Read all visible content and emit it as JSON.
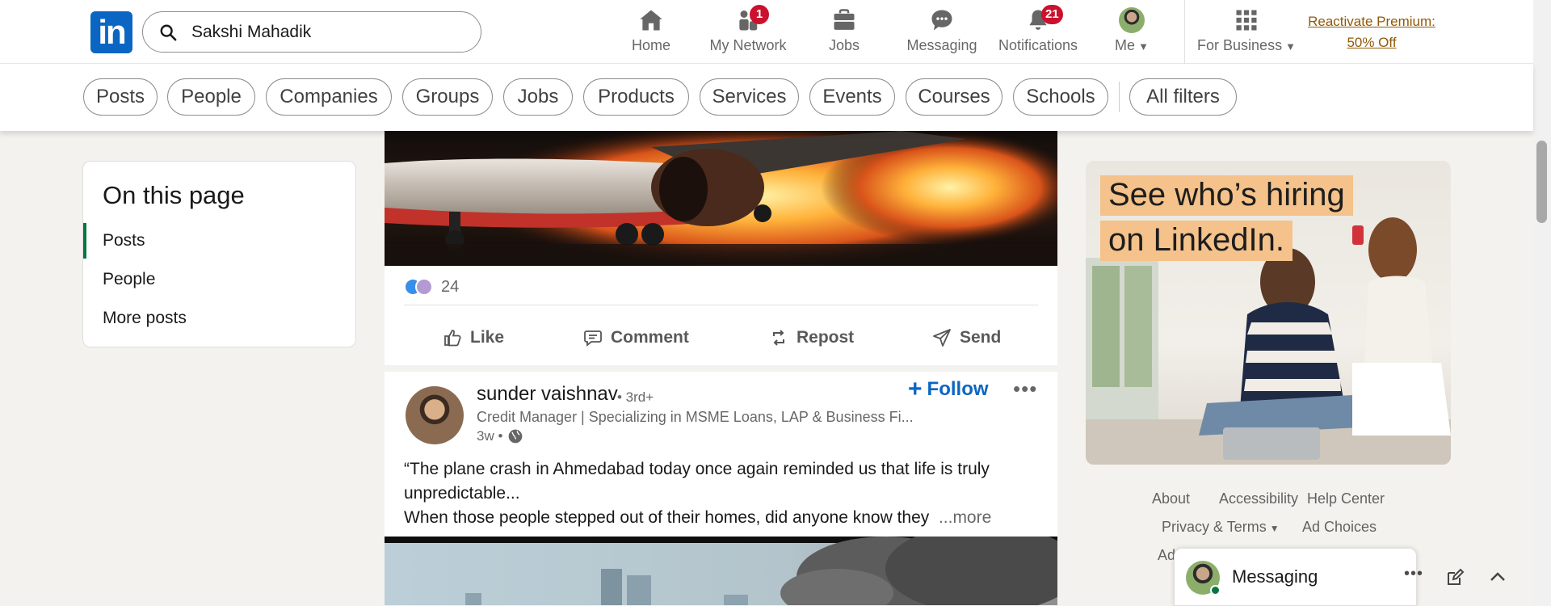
{
  "search": {
    "value": "Sakshi Mahadik"
  },
  "nav": {
    "home": "Home",
    "network": "My Network",
    "network_badge": "1",
    "jobs": "Jobs",
    "messaging": "Messaging",
    "notifications": "Notifications",
    "notifications_badge": "21",
    "me": "Me",
    "business": "For Business",
    "premium_line1": "Reactivate Premium:",
    "premium_line2": "50% Off"
  },
  "filters": [
    "Posts",
    "People",
    "Companies",
    "Groups",
    "Jobs",
    "Products",
    "Services",
    "Events",
    "Courses",
    "Schools"
  ],
  "all_filters": "All filters",
  "on_this_page": {
    "title": "On this page",
    "items": [
      "Posts",
      "People",
      "More posts"
    ]
  },
  "post1": {
    "reactions_count": "24",
    "actions": {
      "like": "Like",
      "comment": "Comment",
      "repost": "Repost",
      "send": "Send"
    }
  },
  "post2": {
    "author": "sunder vaishnav",
    "degree": "• 3rd+",
    "headline": "Credit Manager | Specializing in MSME Loans, LAP & Business Fi...",
    "time": "3w •",
    "follow": "Follow",
    "text_line1": "“The plane crash in Ahmedabad today once again reminded us that life is truly",
    "text_line2": "unpredictable...",
    "text_line3": "When those people stepped out of their homes, did anyone know they",
    "more": "...more"
  },
  "ad": {
    "line1": "See who’s hiring",
    "line2": "on LinkedIn."
  },
  "footer": {
    "about": "About",
    "accessibility": "Accessibility",
    "help": "Help Center",
    "privacy": "Privacy & Terms",
    "ad_choices": "Ad Choices",
    "partial": "Ad"
  },
  "messaging": {
    "title": "Messaging"
  },
  "colors": {
    "brand": "#0a66c2",
    "badge": "#cb112d",
    "premium": "#915907",
    "active_green": "#057642"
  }
}
